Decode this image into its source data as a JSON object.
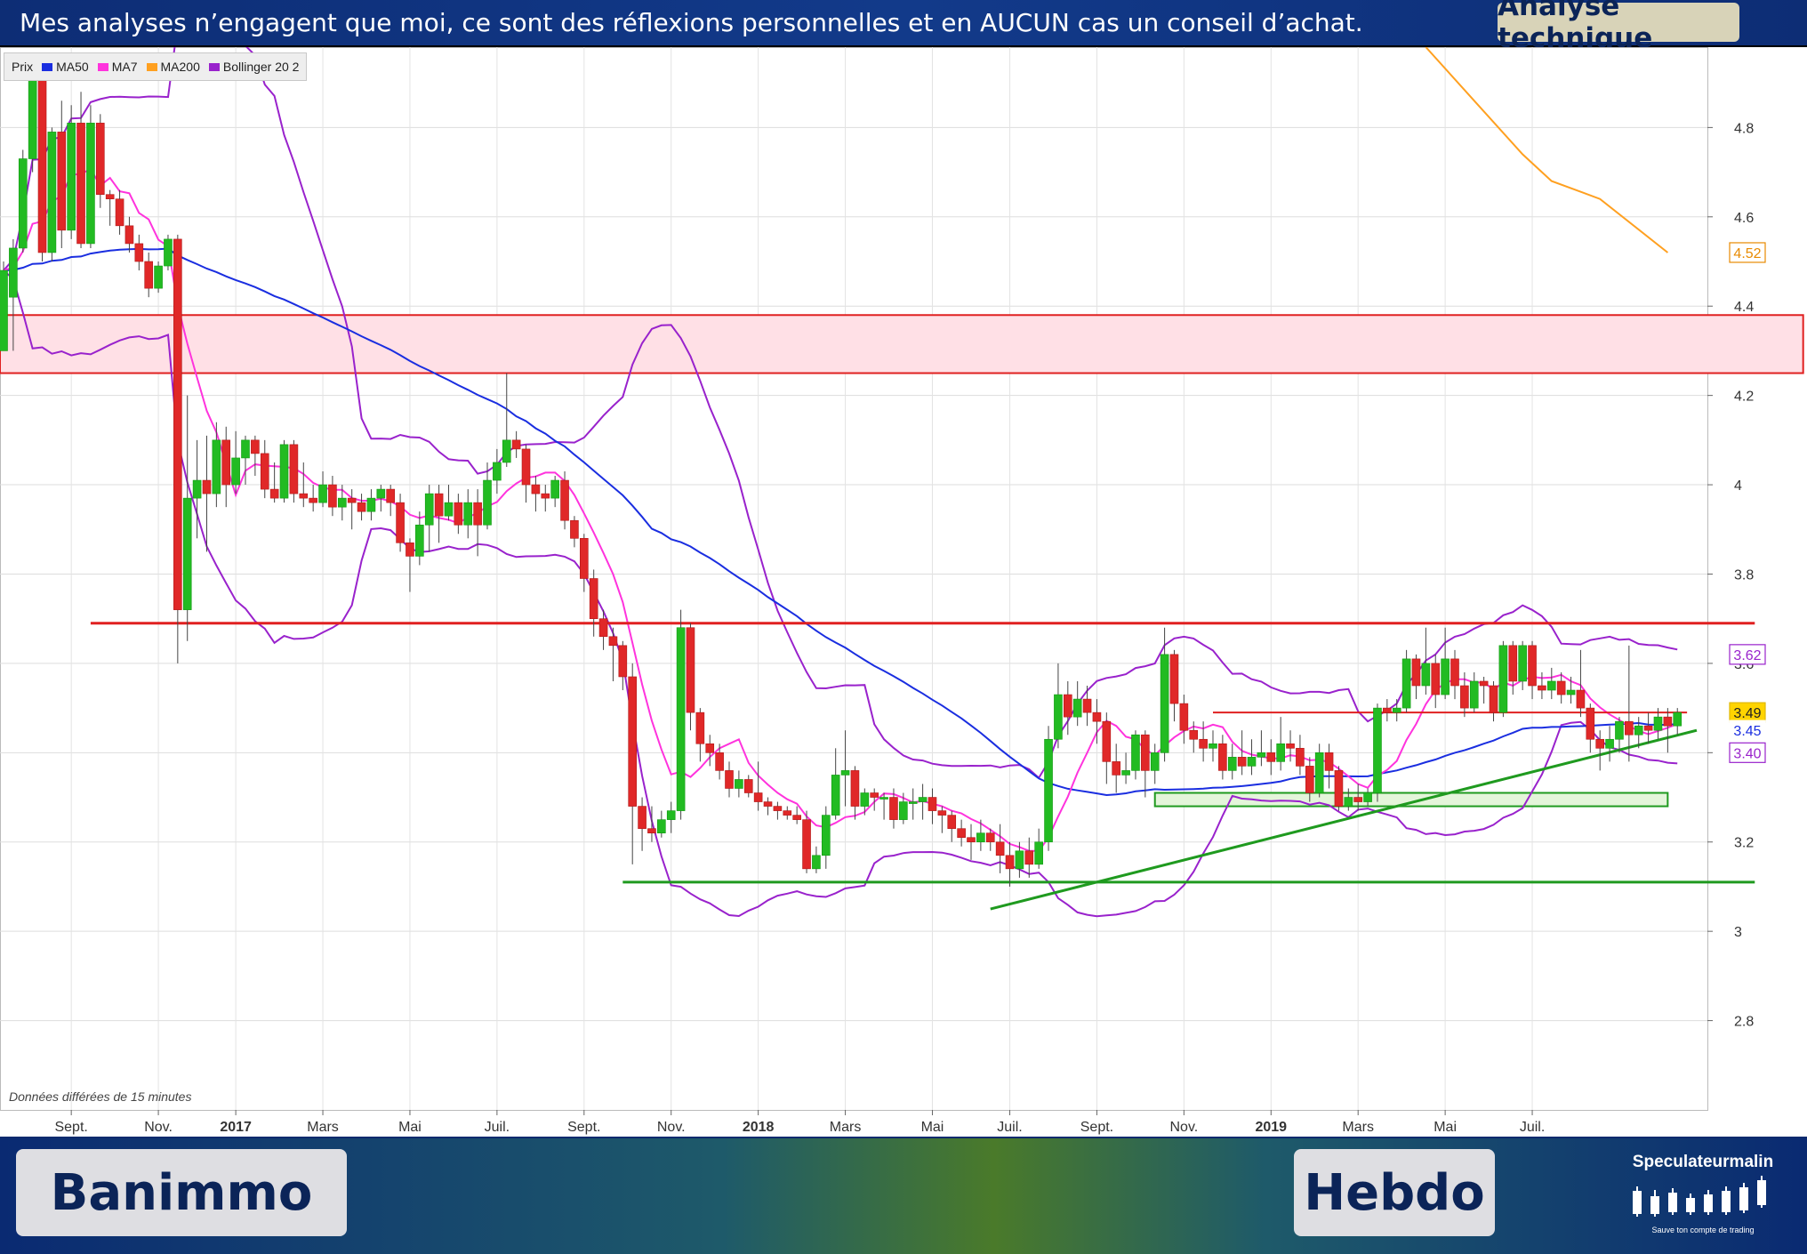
{
  "header": {
    "disclaimer": "Mes analyses n’engagent que moi, ce sont des réflexions personnelles et en AUCUN cas un conseil d’achat.",
    "tag": "Analyse technique"
  },
  "footer": {
    "ticker": "Banimmo",
    "timeframe": "Hebdo",
    "brand": "Speculateurmalin",
    "slogan": "Sauve ton compte de trading"
  },
  "delay_note": "Données différées de 15 minutes",
  "colors": {
    "up": "#22bb22",
    "down": "#e02828",
    "ma50": "#1a2ee0",
    "ma7": "#ff33dd",
    "ma200": "#ffa020",
    "bollinger": "#9922cc",
    "resistance": "#e02020",
    "support": "#1f9a1f"
  },
  "chart_data": {
    "type": "candlestick",
    "legend": [
      {
        "label": "Prix",
        "color": ""
      },
      {
        "label": "MA50",
        "color": "#1a2ee0"
      },
      {
        "label": "MA7",
        "color": "#ff33dd"
      },
      {
        "label": "MA200",
        "color": "#ffa020"
      },
      {
        "label": "Bollinger 20 2",
        "color": "#9922cc"
      }
    ],
    "x_ticks": [
      {
        "label": "Sept.",
        "bold": false,
        "week": 7
      },
      {
        "label": "Nov.",
        "bold": false,
        "week": 16
      },
      {
        "label": "2017",
        "bold": true,
        "week": 24
      },
      {
        "label": "Mars",
        "bold": false,
        "week": 33
      },
      {
        "label": "Mai",
        "bold": false,
        "week": 42
      },
      {
        "label": "Juil.",
        "bold": false,
        "week": 51
      },
      {
        "label": "Sept.",
        "bold": false,
        "week": 60
      },
      {
        "label": "Nov.",
        "bold": false,
        "week": 69
      },
      {
        "label": "2018",
        "bold": true,
        "week": 78
      },
      {
        "label": "Mars",
        "bold": false,
        "week": 87
      },
      {
        "label": "Mai",
        "bold": false,
        "week": 96
      },
      {
        "label": "Juil.",
        "bold": false,
        "week": 104
      },
      {
        "label": "Sept.",
        "bold": false,
        "week": 113
      },
      {
        "label": "Nov.",
        "bold": false,
        "week": 122
      },
      {
        "label": "2019",
        "bold": true,
        "week": 131
      },
      {
        "label": "Mars",
        "bold": false,
        "week": 140
      },
      {
        "label": "Mai",
        "bold": false,
        "week": 149
      },
      {
        "label": "Juil.",
        "bold": false,
        "week": 158
      }
    ],
    "y_ticks": [
      2.8,
      3,
      3.2,
      3.4,
      3.6,
      3.8,
      4,
      4.2,
      4.4,
      4.6,
      4.8
    ],
    "ylim": [
      2.6,
      4.98
    ],
    "xlim": [
      0,
      162
    ],
    "candles": [
      [
        4.3,
        4.48,
        4.4,
        4.5
      ],
      [
        4.42,
        4.53,
        4.3,
        4.55
      ],
      [
        4.53,
        4.73,
        4.52,
        4.75
      ],
      [
        4.73,
        4.91,
        4.7,
        4.92
      ],
      [
        4.91,
        4.52,
        4.5,
        4.93
      ],
      [
        4.52,
        4.79,
        4.5,
        4.8
      ],
      [
        4.79,
        4.57,
        4.53,
        4.86
      ],
      [
        4.57,
        4.81,
        4.55,
        4.85
      ],
      [
        4.81,
        4.54,
        4.53,
        4.88
      ],
      [
        4.54,
        4.81,
        4.53,
        4.85
      ],
      [
        4.81,
        4.65,
        4.62,
        4.83
      ],
      [
        4.65,
        4.64,
        4.58,
        4.66
      ],
      [
        4.64,
        4.58,
        4.56,
        4.66
      ],
      [
        4.58,
        4.54,
        4.52,
        4.6
      ],
      [
        4.54,
        4.5,
        4.48,
        4.56
      ],
      [
        4.5,
        4.44,
        4.42,
        4.52
      ],
      [
        4.44,
        4.49,
        4.43,
        4.5
      ],
      [
        4.49,
        4.55,
        4.48,
        4.56
      ],
      [
        4.55,
        3.72,
        3.6,
        4.56
      ],
      [
        3.72,
        3.97,
        3.65,
        4.2
      ],
      [
        3.97,
        4.01,
        3.88,
        4.1
      ],
      [
        4.01,
        3.98,
        3.85,
        4.11
      ],
      [
        3.98,
        4.1,
        3.95,
        4.14
      ],
      [
        4.1,
        4.0,
        3.95,
        4.13
      ],
      [
        4.0,
        4.06,
        3.98,
        4.12
      ],
      [
        4.06,
        4.1,
        4.0,
        4.11
      ],
      [
        4.1,
        4.07,
        4.02,
        4.11
      ],
      [
        4.07,
        3.99,
        3.97,
        4.1
      ],
      [
        3.99,
        3.97,
        3.96,
        4.05
      ],
      [
        3.97,
        4.09,
        3.96,
        4.1
      ],
      [
        4.09,
        3.98,
        3.96,
        4.1
      ],
      [
        3.98,
        3.97,
        3.95,
        4.05
      ],
      [
        3.97,
        3.96,
        3.94,
        4.0
      ],
      [
        3.96,
        4.0,
        3.95,
        4.03
      ],
      [
        4.0,
        3.95,
        3.93,
        4.02
      ],
      [
        3.95,
        3.97,
        3.92,
        4.0
      ],
      [
        3.97,
        3.96,
        3.9,
        3.99
      ],
      [
        3.96,
        3.94,
        3.92,
        3.98
      ],
      [
        3.94,
        3.97,
        3.92,
        3.99
      ],
      [
        3.97,
        3.99,
        3.94,
        4.0
      ],
      [
        3.99,
        3.96,
        3.93,
        4.0
      ],
      [
        3.96,
        3.87,
        3.85,
        3.98
      ],
      [
        3.87,
        3.84,
        3.76,
        3.88
      ],
      [
        3.84,
        3.91,
        3.82,
        3.94
      ],
      [
        3.91,
        3.98,
        3.85,
        4.0
      ],
      [
        3.98,
        3.93,
        3.87,
        4.0
      ],
      [
        3.93,
        3.96,
        3.92,
        4.0
      ],
      [
        3.96,
        3.91,
        3.89,
        3.98
      ],
      [
        3.91,
        3.96,
        3.88,
        3.99
      ],
      [
        3.96,
        3.91,
        3.84,
        3.99
      ],
      [
        3.91,
        4.01,
        3.9,
        4.05
      ],
      [
        4.01,
        4.05,
        3.98,
        4.08
      ],
      [
        4.05,
        4.1,
        4.04,
        4.25
      ],
      [
        4.1,
        4.08,
        4.06,
        4.12
      ],
      [
        4.08,
        4.0,
        3.96,
        4.09
      ],
      [
        4.0,
        3.98,
        3.94,
        4.02
      ],
      [
        3.98,
        3.97,
        3.94,
        4.0
      ],
      [
        3.97,
        4.01,
        3.95,
        4.02
      ],
      [
        4.01,
        3.92,
        3.9,
        4.03
      ],
      [
        3.92,
        3.88,
        3.86,
        3.93
      ],
      [
        3.88,
        3.79,
        3.76,
        3.89
      ],
      [
        3.79,
        3.7,
        3.66,
        3.81
      ],
      [
        3.7,
        3.66,
        3.63,
        3.72
      ],
      [
        3.66,
        3.64,
        3.56,
        3.68
      ],
      [
        3.64,
        3.57,
        3.54,
        3.65
      ],
      [
        3.57,
        3.28,
        3.15,
        3.6
      ],
      [
        3.28,
        3.23,
        3.18,
        3.3
      ],
      [
        3.23,
        3.22,
        3.2,
        3.28
      ],
      [
        3.22,
        3.25,
        3.21,
        3.27
      ],
      [
        3.25,
        3.27,
        3.22,
        3.29
      ],
      [
        3.27,
        3.68,
        3.25,
        3.72
      ],
      [
        3.68,
        3.49,
        3.45,
        3.69
      ],
      [
        3.49,
        3.42,
        3.38,
        3.5
      ],
      [
        3.42,
        3.4,
        3.37,
        3.44
      ],
      [
        3.4,
        3.36,
        3.34,
        3.42
      ],
      [
        3.36,
        3.32,
        3.3,
        3.38
      ],
      [
        3.32,
        3.34,
        3.3,
        3.36
      ],
      [
        3.34,
        3.31,
        3.3,
        3.35
      ],
      [
        3.31,
        3.29,
        3.27,
        3.38
      ],
      [
        3.29,
        3.28,
        3.26,
        3.3
      ],
      [
        3.28,
        3.27,
        3.25,
        3.29
      ],
      [
        3.27,
        3.26,
        3.25,
        3.28
      ],
      [
        3.26,
        3.25,
        3.24,
        3.28
      ],
      [
        3.25,
        3.14,
        3.13,
        3.27
      ],
      [
        3.14,
        3.17,
        3.13,
        3.19
      ],
      [
        3.17,
        3.26,
        3.14,
        3.28
      ],
      [
        3.26,
        3.35,
        3.25,
        3.41
      ],
      [
        3.35,
        3.36,
        3.28,
        3.45
      ],
      [
        3.36,
        3.28,
        3.25,
        3.37
      ],
      [
        3.28,
        3.31,
        3.26,
        3.32
      ],
      [
        3.31,
        3.3,
        3.27,
        3.32
      ],
      [
        3.3,
        3.3,
        3.25,
        3.31
      ],
      [
        3.3,
        3.25,
        3.23,
        3.32
      ],
      [
        3.25,
        3.29,
        3.24,
        3.31
      ],
      [
        3.29,
        3.29,
        3.25,
        3.32
      ],
      [
        3.29,
        3.3,
        3.25,
        3.33
      ],
      [
        3.3,
        3.27,
        3.24,
        3.32
      ],
      [
        3.27,
        3.26,
        3.22,
        3.28
      ],
      [
        3.26,
        3.23,
        3.2,
        3.27
      ],
      [
        3.23,
        3.21,
        3.19,
        3.25
      ],
      [
        3.21,
        3.2,
        3.16,
        3.24
      ],
      [
        3.2,
        3.22,
        3.18,
        3.25
      ],
      [
        3.22,
        3.2,
        3.18,
        3.23
      ],
      [
        3.2,
        3.17,
        3.13,
        3.24
      ],
      [
        3.17,
        3.14,
        3.1,
        3.2
      ],
      [
        3.14,
        3.18,
        3.12,
        3.2
      ],
      [
        3.18,
        3.15,
        3.12,
        3.21
      ],
      [
        3.15,
        3.2,
        3.14,
        3.23
      ],
      [
        3.2,
        3.43,
        3.18,
        3.46
      ],
      [
        3.43,
        3.53,
        3.41,
        3.6
      ],
      [
        3.53,
        3.48,
        3.44,
        3.56
      ],
      [
        3.48,
        3.52,
        3.46,
        3.56
      ],
      [
        3.52,
        3.49,
        3.46,
        3.55
      ],
      [
        3.49,
        3.47,
        3.42,
        3.52
      ],
      [
        3.47,
        3.38,
        3.33,
        3.49
      ],
      [
        3.38,
        3.35,
        3.31,
        3.42
      ],
      [
        3.35,
        3.36,
        3.33,
        3.4
      ],
      [
        3.36,
        3.44,
        3.34,
        3.45
      ],
      [
        3.44,
        3.36,
        3.3,
        3.45
      ],
      [
        3.36,
        3.4,
        3.33,
        3.42
      ],
      [
        3.4,
        3.62,
        3.38,
        3.68
      ],
      [
        3.62,
        3.51,
        3.47,
        3.63
      ],
      [
        3.51,
        3.45,
        3.42,
        3.53
      ],
      [
        3.45,
        3.43,
        3.4,
        3.47
      ],
      [
        3.43,
        3.41,
        3.38,
        3.47
      ],
      [
        3.41,
        3.42,
        3.38,
        3.45
      ],
      [
        3.42,
        3.36,
        3.34,
        3.44
      ],
      [
        3.36,
        3.39,
        3.34,
        3.42
      ],
      [
        3.39,
        3.37,
        3.35,
        3.45
      ],
      [
        3.37,
        3.39,
        3.35,
        3.43
      ],
      [
        3.39,
        3.4,
        3.37,
        3.45
      ],
      [
        3.4,
        3.38,
        3.35,
        3.43
      ],
      [
        3.38,
        3.42,
        3.36,
        3.48
      ],
      [
        3.42,
        3.41,
        3.38,
        3.45
      ],
      [
        3.41,
        3.37,
        3.35,
        3.44
      ],
      [
        3.37,
        3.31,
        3.29,
        3.39
      ],
      [
        3.31,
        3.4,
        3.3,
        3.42
      ],
      [
        3.4,
        3.36,
        3.32,
        3.42
      ],
      [
        3.36,
        3.28,
        3.27,
        3.37
      ],
      [
        3.28,
        3.3,
        3.27,
        3.32
      ],
      [
        3.3,
        3.29,
        3.27,
        3.33
      ],
      [
        3.29,
        3.31,
        3.28,
        3.32
      ],
      [
        3.31,
        3.5,
        3.29,
        3.51
      ],
      [
        3.5,
        3.49,
        3.47,
        3.52
      ],
      [
        3.49,
        3.5,
        3.47,
        3.52
      ],
      [
        3.5,
        3.61,
        3.49,
        3.63
      ],
      [
        3.61,
        3.55,
        3.52,
        3.62
      ],
      [
        3.55,
        3.6,
        3.53,
        3.68
      ],
      [
        3.6,
        3.53,
        3.5,
        3.62
      ],
      [
        3.53,
        3.61,
        3.52,
        3.68
      ],
      [
        3.61,
        3.55,
        3.52,
        3.63
      ],
      [
        3.55,
        3.5,
        3.48,
        3.58
      ],
      [
        3.5,
        3.56,
        3.49,
        3.58
      ],
      [
        3.56,
        3.55,
        3.51,
        3.57
      ],
      [
        3.55,
        3.49,
        3.47,
        3.56
      ],
      [
        3.49,
        3.64,
        3.48,
        3.65
      ],
      [
        3.64,
        3.56,
        3.53,
        3.65
      ],
      [
        3.56,
        3.64,
        3.54,
        3.65
      ],
      [
        3.64,
        3.55,
        3.52,
        3.65
      ],
      [
        3.55,
        3.54,
        3.52,
        3.58
      ],
      [
        3.54,
        3.56,
        3.52,
        3.59
      ],
      [
        3.56,
        3.53,
        3.51,
        3.58
      ],
      [
        3.53,
        3.54,
        3.51,
        3.57
      ],
      [
        3.54,
        3.5,
        3.48,
        3.63
      ],
      [
        3.5,
        3.43,
        3.4,
        3.51
      ],
      [
        3.43,
        3.41,
        3.36,
        3.45
      ],
      [
        3.41,
        3.43,
        3.38,
        3.46
      ],
      [
        3.43,
        3.47,
        3.4,
        3.48
      ],
      [
        3.47,
        3.44,
        3.38,
        3.64
      ],
      [
        3.44,
        3.46,
        3.41,
        3.48
      ],
      [
        3.46,
        3.45,
        3.42,
        3.49
      ],
      [
        3.45,
        3.48,
        3.43,
        3.5
      ],
      [
        3.48,
        3.46,
        3.4,
        3.5
      ],
      [
        3.46,
        3.49,
        3.44,
        3.5
      ]
    ],
    "price_label": 3.49,
    "value_labels": [
      {
        "value": "4.52",
        "series": "ma200",
        "color": "#e88a00",
        "border": "#e88a00",
        "fill": "#ffffff",
        "text": "#e88a00"
      },
      {
        "value": "3.62",
        "series": "bollinger_up",
        "color": "#9922cc",
        "border": "#9922cc",
        "fill": "#ffffff",
        "text": "#9922cc"
      },
      {
        "value": "3.49",
        "series": "price",
        "color": "#e0b800",
        "border": "#e0b800",
        "fill": "#ffd400",
        "text": "#222222"
      },
      {
        "value": "3.45",
        "series": "ma50",
        "color": "#1a2ee0",
        "border": "#ffffff",
        "fill": "#ffffff",
        "text": "#1a2ee0"
      },
      {
        "value": "3.40",
        "series": "bollinger_dn",
        "color": "#9922cc",
        "border": "#9922cc",
        "fill": "#ffffff",
        "text": "#9922cc"
      }
    ],
    "annotations": {
      "zone_resistance": {
        "x0": 0,
        "x1": 186,
        "y_low": 4.25,
        "y_high": 4.38,
        "fill": "#ffe0e6",
        "stroke": "#e02020"
      },
      "hline_resistance": {
        "x0": 9,
        "x1": 181,
        "y": 3.69
      },
      "hline_resistance_small": {
        "x0": 125,
        "x1": 174,
        "y": 3.49
      },
      "zone_support": {
        "x0": 119,
        "x1": 172,
        "y_low": 3.28,
        "y_high": 3.31,
        "fill": "#e4f5da",
        "stroke": "#1f9a1f"
      },
      "hline_support": {
        "x0": 64,
        "x1": 181,
        "y": 3.11
      },
      "trendline": {
        "x0": 102,
        "y0": 3.05,
        "x1": 175,
        "y1": 3.45
      }
    },
    "ma200": [
      [
        147,
        4.98
      ],
      [
        152,
        4.86
      ],
      [
        157,
        4.74
      ],
      [
        160,
        4.68
      ],
      [
        165,
        4.64
      ],
      [
        172,
        4.52
      ]
    ]
  }
}
